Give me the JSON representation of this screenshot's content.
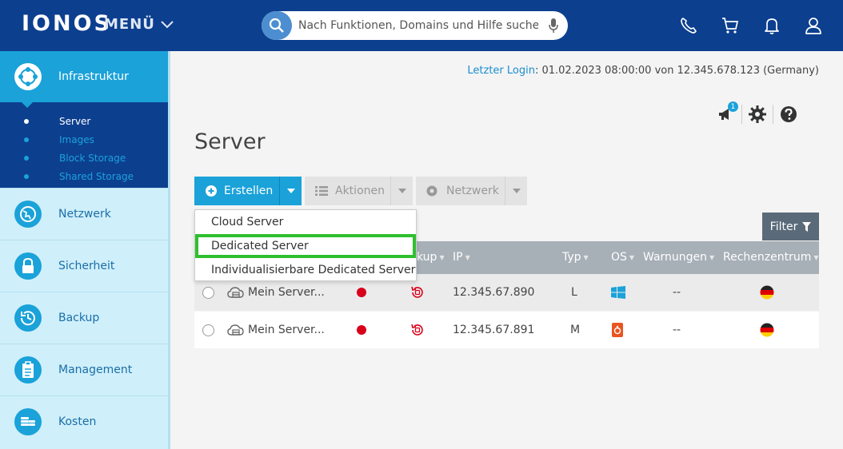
{
  "header": {
    "logo": "IONOS",
    "menu_label": "MENÜ",
    "search_placeholder": "Nach Funktionen, Domains und Hilfe suchen",
    "icons": [
      "phone-icon",
      "cart-icon",
      "bell-icon",
      "user-icon"
    ]
  },
  "sidebar": {
    "active": {
      "label": "Infrastruktur",
      "icon": "infrastructure-icon"
    },
    "submenu": [
      {
        "label": "Server",
        "active": true
      },
      {
        "label": "Images",
        "active": false
      },
      {
        "label": "Block Storage",
        "active": false
      },
      {
        "label": "Shared Storage",
        "active": false
      }
    ],
    "items": [
      {
        "label": "Netzwerk",
        "icon": "network-globe-icon"
      },
      {
        "label": "Sicherheit",
        "icon": "lock-icon"
      },
      {
        "label": "Backup",
        "icon": "backup-clock-icon"
      },
      {
        "label": "Management",
        "icon": "clipboard-icon"
      },
      {
        "label": "Kosten",
        "icon": "coins-icon"
      }
    ]
  },
  "main": {
    "last_login_label": "Letzter Login",
    "last_login_value": ": 01.02.2023 08:00:00 von 12.345.678.123 (Germany)",
    "notifications_badge": "1",
    "title": "Server",
    "buttons": {
      "create": "Erstellen",
      "actions": "Aktionen",
      "network": "Netzwerk",
      "filter": "Filter"
    },
    "dropdown": [
      "Cloud Server",
      "Dedicated Server",
      "Individualisierbare Dedicated Server"
    ],
    "table": {
      "headers": {
        "backup": "kup",
        "ip": "IP",
        "typ": "Typ",
        "os": "OS",
        "warnings": "Warnungen",
        "datacenter": "Rechenzentrum"
      },
      "rows": [
        {
          "name": "Mein Server...",
          "ip": "12.345.67.890",
          "typ": "L",
          "os": "windows",
          "warnings": "--",
          "status_color": "#d9001b"
        },
        {
          "name": "Mein Server...",
          "ip": "12.345.67.891",
          "typ": "M",
          "os": "ubuntu",
          "warnings": "--",
          "status_color": "#d9001b"
        }
      ]
    }
  },
  "colors": {
    "header_bg": "#0d3f8f",
    "accent": "#1aa2d9",
    "sidebar_bg": "#cfeffa",
    "highlight": "#2fbf2f",
    "status_red": "#d9001b"
  }
}
